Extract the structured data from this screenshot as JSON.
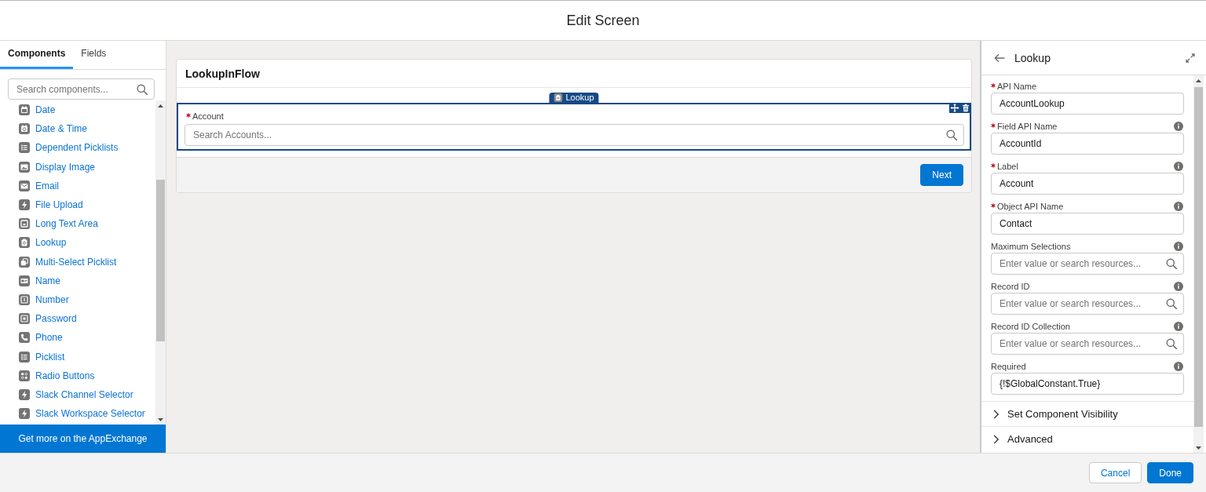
{
  "header": {
    "title": "Edit Screen"
  },
  "sidebar": {
    "tabs": [
      {
        "label": "Components",
        "selected": true
      },
      {
        "label": "Fields",
        "selected": false
      }
    ],
    "search": {
      "placeholder": "Search components..."
    },
    "items": [
      {
        "label": "Date",
        "kind": "calendar"
      },
      {
        "label": "Date & Time",
        "kind": "datetime"
      },
      {
        "label": "Dependent Picklists",
        "kind": "list"
      },
      {
        "label": "Display Image",
        "kind": "image"
      },
      {
        "label": "Email",
        "kind": "envelope"
      },
      {
        "label": "File Upload",
        "kind": "bolt"
      },
      {
        "label": "Long Text Area",
        "kind": "textarea"
      },
      {
        "label": "Lookup",
        "kind": "clipboard"
      },
      {
        "label": "Multi-Select Picklist",
        "kind": "stack"
      },
      {
        "label": "Name",
        "kind": "card"
      },
      {
        "label": "Number",
        "kind": "number"
      },
      {
        "label": "Password",
        "kind": "password"
      },
      {
        "label": "Phone",
        "kind": "phone"
      },
      {
        "label": "Picklist",
        "kind": "list"
      },
      {
        "label": "Radio Buttons",
        "kind": "radios"
      },
      {
        "label": "Slack Channel Selector",
        "kind": "bolt"
      },
      {
        "label": "Slack Workspace Selector",
        "kind": "bolt"
      }
    ],
    "appexchange_button": "Get more on the AppExchange"
  },
  "canvas": {
    "screen_title": "LookupInFlow",
    "component": {
      "type_tag": "Lookup",
      "selected": true,
      "label": "Account",
      "required": true,
      "placeholder": "Search Accounts..."
    },
    "next_button": "Next"
  },
  "properties": {
    "title": "Lookup",
    "fields": [
      {
        "label": "API Name",
        "required": true,
        "help": false,
        "kind": "text",
        "value": "AccountLookup"
      },
      {
        "label": "Field API Name",
        "required": true,
        "help": true,
        "kind": "text",
        "value": "AccountId"
      },
      {
        "label": "Label",
        "required": true,
        "help": true,
        "kind": "text",
        "value": "Account"
      },
      {
        "label": "Object API Name",
        "required": true,
        "help": true,
        "kind": "text",
        "value": "Contact"
      },
      {
        "label": "Maximum Selections",
        "required": false,
        "help": true,
        "kind": "resource",
        "placeholder": "Enter value or search resources..."
      },
      {
        "label": "Record ID",
        "required": false,
        "help": true,
        "kind": "resource",
        "placeholder": "Enter value or search resources..."
      },
      {
        "label": "Record ID Collection",
        "required": false,
        "help": true,
        "kind": "resource",
        "placeholder": "Enter value or search resources..."
      },
      {
        "label": "Required",
        "required": false,
        "help": true,
        "kind": "text",
        "value": "{!$GlobalConstant.True}"
      }
    ],
    "sections": [
      {
        "label": "Set Component Visibility",
        "expanded": false
      },
      {
        "label": "Advanced",
        "expanded": false
      }
    ]
  },
  "footer": {
    "buttons": [
      {
        "label": "Cancel",
        "kind": "neutral"
      },
      {
        "label": "Done",
        "kind": "brand"
      }
    ]
  }
}
